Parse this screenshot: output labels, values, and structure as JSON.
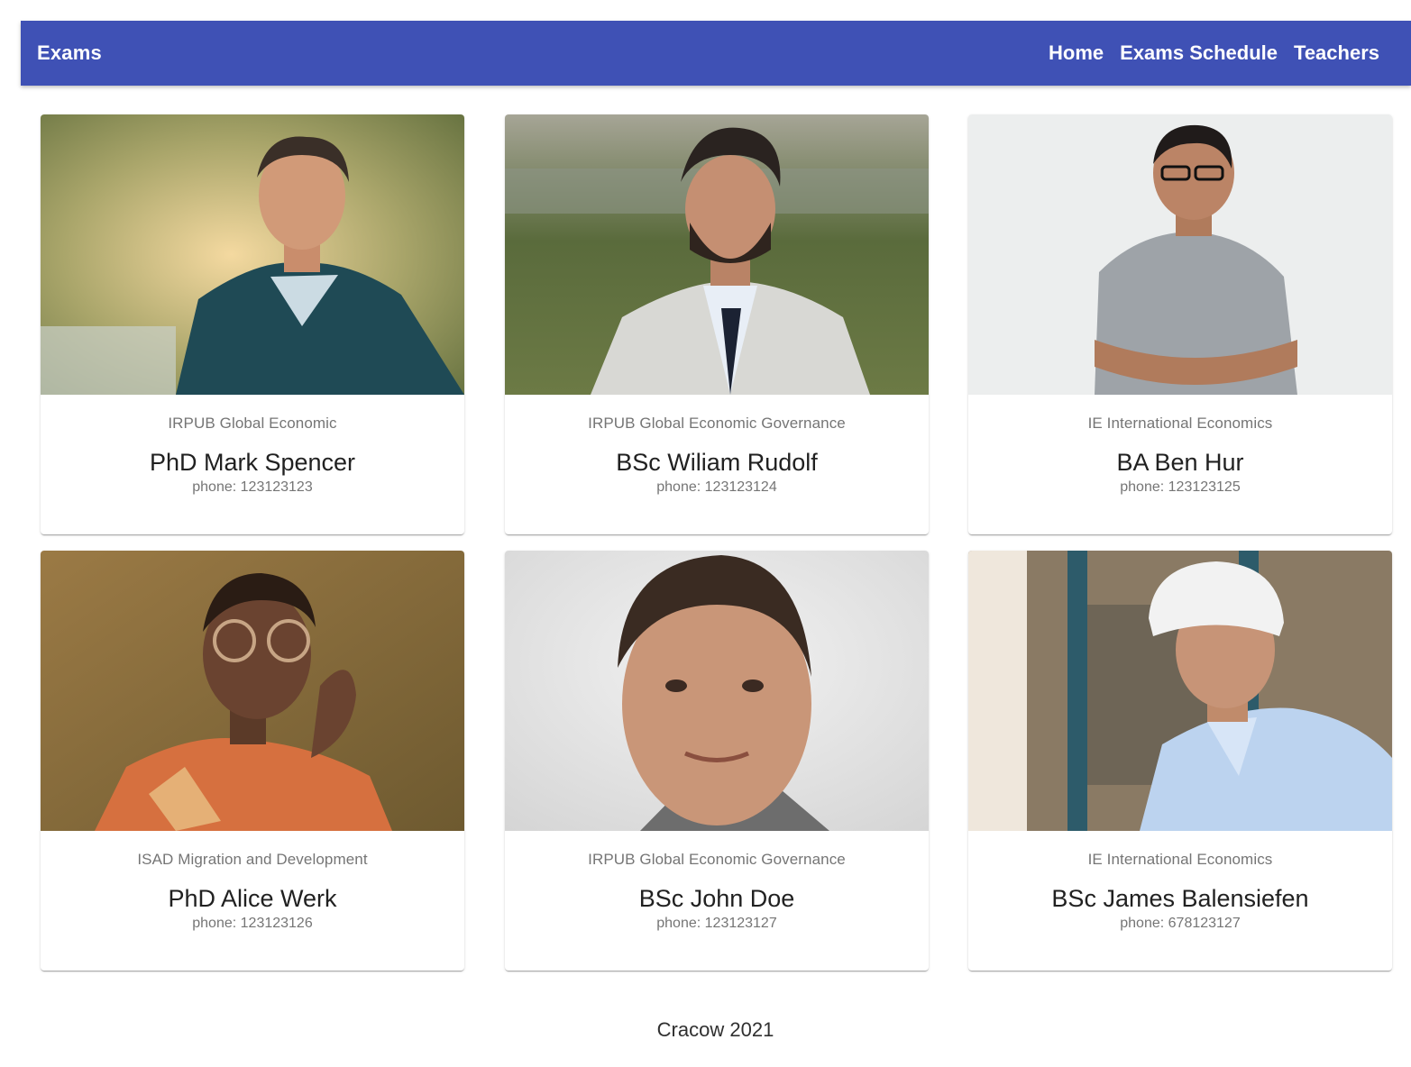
{
  "header": {
    "title": "Exams",
    "nav": [
      {
        "label": "Home"
      },
      {
        "label": "Exams Schedule"
      },
      {
        "label": "Teachers"
      }
    ]
  },
  "teachers": [
    {
      "subject": "IRPUB Global Economic",
      "name": "PhD Mark Spencer",
      "phone": "123123123"
    },
    {
      "subject": "IRPUB Global Economic Governance",
      "name": "BSc Wiliam Rudolf",
      "phone": "123123124"
    },
    {
      "subject": "IE International Economics",
      "name": "BA Ben Hur",
      "phone": "123123125"
    },
    {
      "subject": "ISAD Migration and Development",
      "name": "PhD Alice Werk",
      "phone": "123123126"
    },
    {
      "subject": "IRPUB Global Economic Governance",
      "name": "BSc John Doe",
      "phone": "123123127"
    },
    {
      "subject": "IE International Economics",
      "name": "BSc James Balensiefen",
      "phone": "678123127"
    }
  ],
  "phone_prefix": "phone:",
  "footer": {
    "text": "Cracow 2021"
  },
  "colors": {
    "primary": "#3f51b5"
  }
}
